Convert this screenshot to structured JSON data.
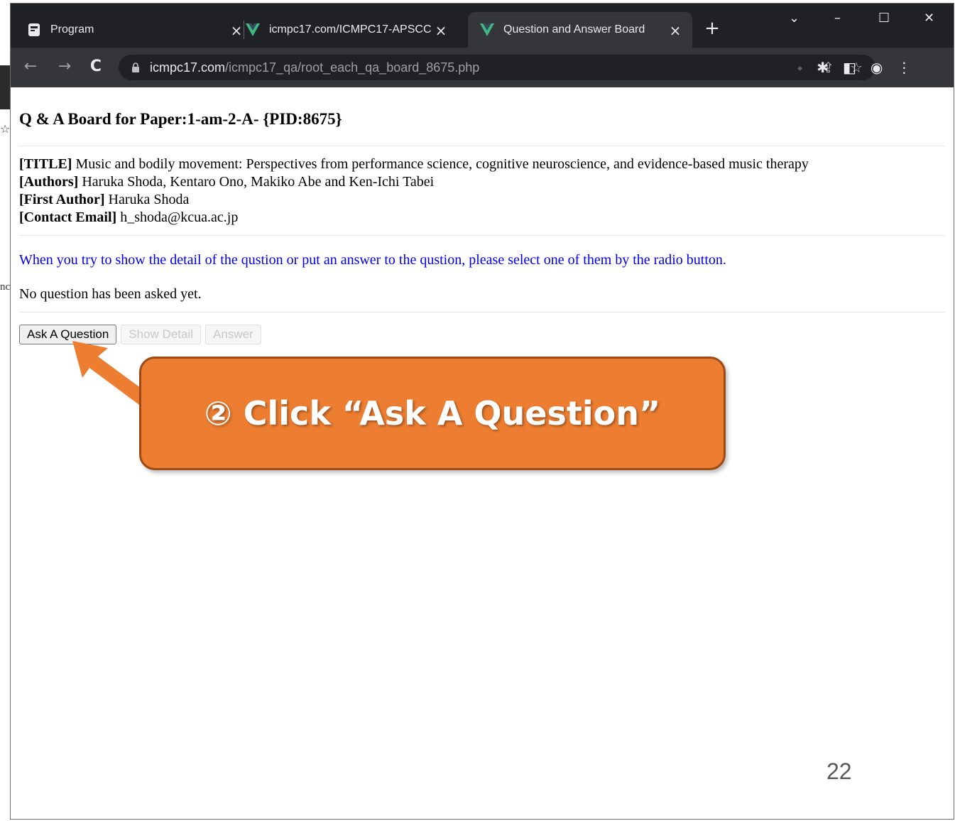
{
  "slide_left": {
    "fragment_text": "nc"
  },
  "tabs": [
    {
      "title": "Program",
      "icon": "document-icon"
    },
    {
      "title": "icmpc17.com/ICMPC17-APSCC",
      "icon": "vue-logo-icon"
    },
    {
      "title": "Question and Answer Board",
      "icon": "vue-logo-icon",
      "active": true
    }
  ],
  "address_bar": {
    "host": "icmpc17.com",
    "path": "/icmpc17_qa/root_each_qa_board_8675.php"
  },
  "page": {
    "title": "Q & A Board for Paper:1-am-2-A- {PID:8675}",
    "meta": [
      {
        "label": "[TITLE]",
        "value": " Music and bodily movement: Perspectives from performance science, cognitive neuroscience, and evidence-based music therapy"
      },
      {
        "label": "[Authors]",
        "value": " Haruka Shoda, Kentaro Ono, Makiko Abe and Ken-Ichi Tabei"
      },
      {
        "label": "[First Author]",
        "value": " Haruka Shoda"
      },
      {
        "label": "[Contact Email]",
        "value": " h_shoda@kcua.ac.jp"
      }
    ],
    "notice": "When you try to show the detail of the qustion or put an answer to the qustion, please select one of them by the radio button.",
    "empty_message": "No question has been asked yet.",
    "buttons": {
      "ask": "Ask A Question",
      "show_detail": "Show Detail",
      "answer": "Answer"
    }
  },
  "annotation": {
    "text": "② Click “Ask A Question”",
    "color": "#ed7d31"
  },
  "slide_number": "22",
  "colors": {
    "tabstrip": "#202124",
    "toolbar": "#35363a",
    "link_blue": "#0000ee"
  }
}
